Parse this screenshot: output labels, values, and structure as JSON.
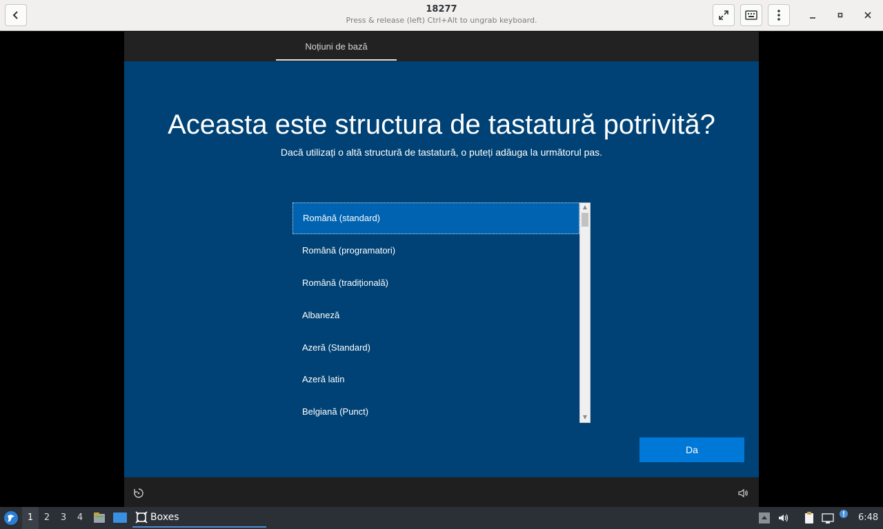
{
  "window": {
    "title": "18277",
    "subtitle": "Press & release (left) Ctrl+Alt to ungrab keyboard."
  },
  "vm": {
    "tab_label": "Noțiuni de bază",
    "heading": "Aceasta este structura de tastatură potrivită?",
    "subheading": "Dacă utilizați o altă structură de tastatură, o puteți adăuga la următorul pas.",
    "layouts": [
      "Română (standard)",
      "Română (programatori)",
      "Română (tradițională)",
      "Albaneză",
      "Azeră (Standard)",
      "Azeră latin",
      "Belgiană (Punct)"
    ],
    "selected_index": 0,
    "confirm_label": "Da"
  },
  "taskbar": {
    "workspaces": [
      "1",
      "2",
      "3",
      "4"
    ],
    "active_workspace": "1",
    "task_label": "Boxes",
    "clock": "6:48"
  },
  "colors": {
    "oobe_background": "#004275",
    "selected_item": "#0063b1",
    "accent_button": "#0078d7"
  },
  "icons": {
    "back": "chevron-left-icon",
    "fullscreen": "fullscreen-icon",
    "keyboard": "keyboard-icon",
    "menu": "kebab-menu-icon",
    "minimize": "minimize-icon",
    "maximize": "maximize-icon",
    "close": "close-icon",
    "ease_of_access": "ease-of-access-icon",
    "volume": "volume-icon"
  }
}
